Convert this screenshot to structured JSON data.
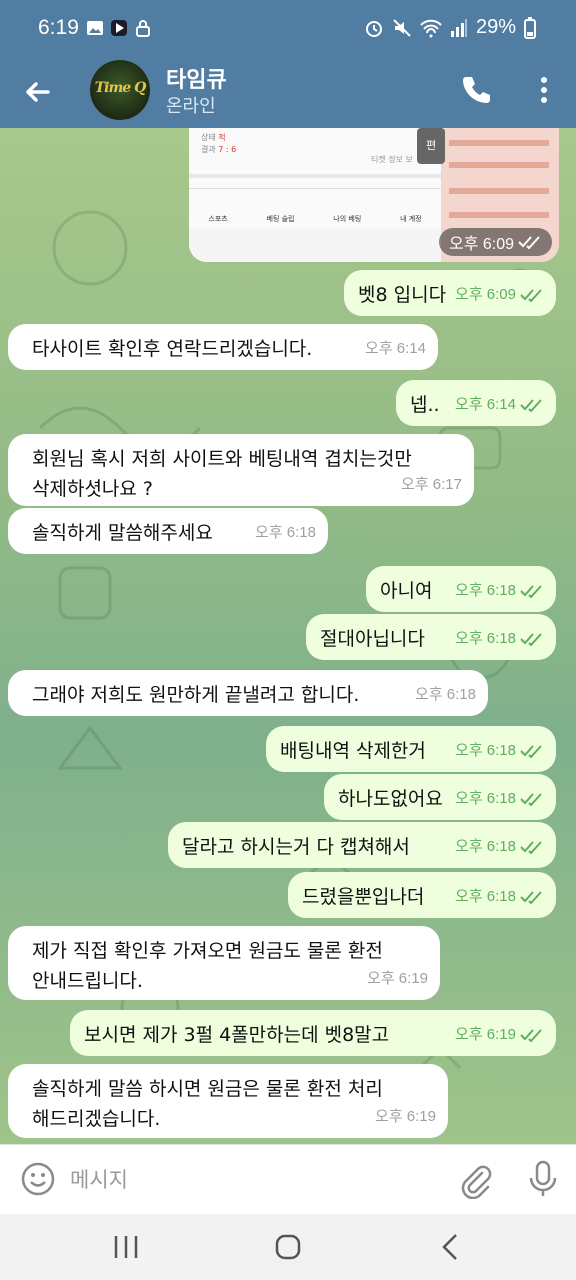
{
  "status_bar": {
    "time": "6:19",
    "battery": "29%"
  },
  "header": {
    "title": "타임큐",
    "subtitle": "온라인",
    "avatar_text": "Time Q"
  },
  "image_message": {
    "time": "오후 6:09",
    "tabs": [
      "스포츠",
      "베팅 슬립",
      "나의 베팅",
      "내 계정"
    ],
    "info_label": "티켓 정보 보",
    "status_label": "상태",
    "status_value": "적",
    "result_label": "결과",
    "result_value": "7 : 6",
    "side_label": "편"
  },
  "messages": [
    {
      "dir": "out",
      "text": "벳8 입니다",
      "time": "오후 6:09"
    },
    {
      "dir": "in",
      "text": "타사이트 확인후 연락드리겠습니다.",
      "time": "오후 6:14"
    },
    {
      "dir": "out",
      "text": "넵..",
      "time": "오후 6:14"
    },
    {
      "dir": "in",
      "text": "회원님 혹시 저희 사이트와 베팅내역 겹치는것만\n삭제하셧나요 ?",
      "time": "오후 6:17"
    },
    {
      "dir": "in",
      "text": "솔직하게 말씀해주세요",
      "time": "오후 6:18"
    },
    {
      "dir": "out",
      "text": "아니여",
      "time": "오후 6:18"
    },
    {
      "dir": "out",
      "text": "절대아닙니다",
      "time": "오후 6:18"
    },
    {
      "dir": "in",
      "text": "그래야 저희도 원만하게 끝낼려고 합니다.",
      "time": "오후 6:18"
    },
    {
      "dir": "out",
      "text": "배팅내역 삭제한거",
      "time": "오후 6:18"
    },
    {
      "dir": "out",
      "text": "하나도없어요",
      "time": "오후 6:18"
    },
    {
      "dir": "out",
      "text": "달라고 하시는거 다 캡쳐해서",
      "time": "오후 6:18"
    },
    {
      "dir": "out",
      "text": "드렸을뿐입나더",
      "time": "오후 6:18"
    },
    {
      "dir": "in",
      "text": "제가 직접 확인후 가져오면 원금도 물론 환전\n안내드립니다.",
      "time": "오후 6:19"
    },
    {
      "dir": "out",
      "text": "보시면 제가 3펄 4폴만하는데 벳8말고",
      "time": "오후 6:19"
    },
    {
      "dir": "in",
      "text": "솔직하게 말씀 하시면 원금은 물론 환전 처리\n해드리겠습니다.",
      "time": "오후 6:19"
    }
  ],
  "input": {
    "placeholder": "메시지"
  },
  "colors": {
    "header": "#527da3",
    "bubble_in": "#ffffff",
    "bubble_out": "#efffde",
    "check": "#5fae5f"
  },
  "icons": [
    "back-arrow-icon",
    "phone-icon",
    "more-vert-icon",
    "emoji-icon",
    "attach-icon",
    "mic-icon",
    "recents-icon",
    "home-icon",
    "nav-back-icon"
  ]
}
